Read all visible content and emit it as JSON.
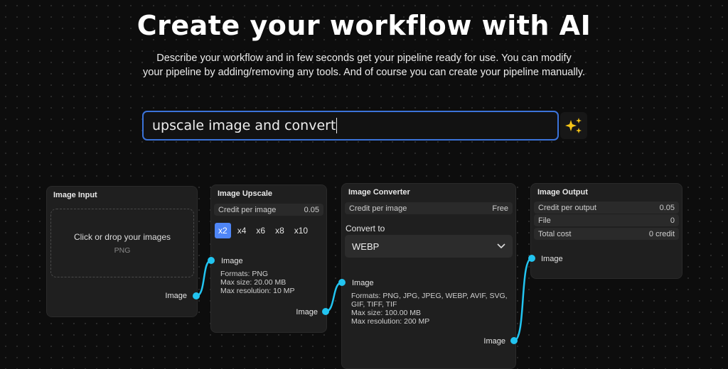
{
  "header": {
    "title": "Create your workflow with AI",
    "subtitle_line1": "Describe your workflow and in few seconds get your pipeline ready for use.  You can modify",
    "subtitle_line2": "your pipeline by adding/removing any tools. And of course you can create your pipeline manually."
  },
  "prompt": {
    "value": "upscale image and convert",
    "button_icon": "sparkles-icon"
  },
  "nodes": {
    "input": {
      "title": "Image Input",
      "drop_text": "Click or drop your images",
      "drop_format": "PNG",
      "output_label": "Image"
    },
    "upscale": {
      "title": "Image Upscale",
      "credit_label": "Credit per image",
      "credit_value": "0.05",
      "scales": [
        "x2",
        "x4",
        "x6",
        "x8",
        "x10"
      ],
      "selected_scale": "x2",
      "input_label": "Image",
      "formats": "Formats: PNG",
      "max_size": "Max size: 20.00 MB",
      "max_res": "Max resolution: 10 MP",
      "output_label": "Image"
    },
    "converter": {
      "title": "Image Converter",
      "credit_label": "Credit per image",
      "credit_value": "Free",
      "convert_label": "Convert to",
      "convert_value": "WEBP",
      "input_label": "Image",
      "formats1": "Formats: PNG, JPG, JPEG, WEBP, AVIF, SVG,",
      "formats2": "GIF, TIFF, TIF",
      "max_size": "Max size: 100.00 MB",
      "max_res": "Max resolution: 200 MP",
      "output_label": "Image"
    },
    "output": {
      "title": "Image Output",
      "rows": [
        {
          "label": "Credit per output",
          "value": "0.05"
        },
        {
          "label": "File",
          "value": "0"
        },
        {
          "label": "Total cost",
          "value": "0 credit"
        }
      ],
      "input_label": "Image"
    }
  },
  "colors": {
    "accent": "#4f86f7",
    "wire": "#22c4f0",
    "sparkle": "#f5c518"
  }
}
